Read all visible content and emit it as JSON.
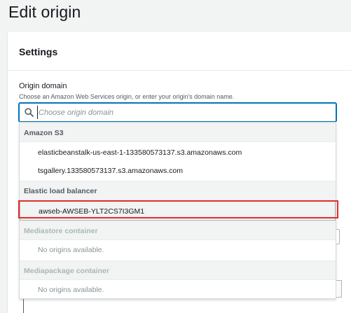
{
  "page": {
    "title": "Edit origin"
  },
  "settings": {
    "heading": "Settings",
    "origin_domain": {
      "label": "Origin domain",
      "description": "Choose an Amazon Web Services origin, or enter your origin's domain name.",
      "value": "",
      "placeholder": "Choose origin domain",
      "search_icon": "search-icon"
    }
  },
  "dropdown": {
    "groups": [
      {
        "label": "Amazon S3",
        "disabled": false,
        "options": [
          "elasticbeanstalk-us-east-1-133580573137.s3.amazonaws.com",
          "tsgallery.133580573137.s3.amazonaws.com"
        ]
      },
      {
        "label": "Elastic load balancer",
        "disabled": false,
        "options": [
          "awseb-AWSEB-YLT2CS7I3GM1"
        ]
      },
      {
        "label": "Mediastore container",
        "disabled": true,
        "options": [
          "No origins available."
        ]
      },
      {
        "label": "Mediapackage container",
        "disabled": true,
        "options": [
          "No origins available."
        ]
      }
    ],
    "highlighted_option": "awseb-AWSEB-YLT2CS7I3GM1"
  },
  "colors": {
    "focus_border": "#0073bb",
    "annotation_box": "#e02f2f",
    "background": "#f2f3f3"
  }
}
